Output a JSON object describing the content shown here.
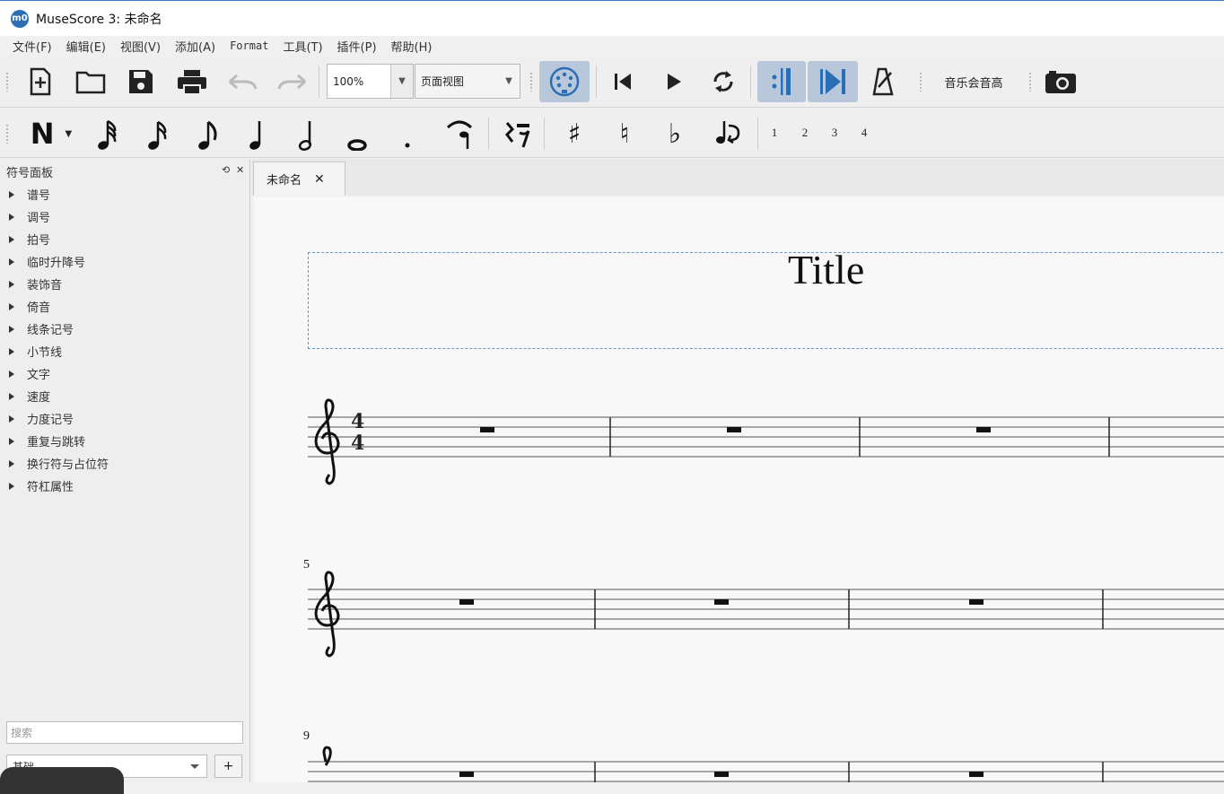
{
  "window": {
    "title": "MuseScore 3: 未命名",
    "app_icon_text": "m0"
  },
  "menu": [
    "文件(F)",
    "编辑(E)",
    "视图(V)",
    "添加(A)",
    "Format",
    "工具(T)",
    "插件(P)",
    "帮助(H)"
  ],
  "toolbar": {
    "zoom_value": "100%",
    "view_mode": "页面视图",
    "concert_pitch_label": "音乐会音高"
  },
  "note_toolbar": {
    "voices": [
      "1",
      "2",
      "3",
      "4"
    ]
  },
  "palette": {
    "header": "符号面板",
    "items": [
      "谱号",
      "调号",
      "拍号",
      "临时升降号",
      "装饰音",
      "倚音",
      "线条记号",
      "小节线",
      "文字",
      "速度",
      "力度记号",
      "重复与跳转",
      "换行符与占位符",
      "符杠属性"
    ],
    "search_placeholder": "搜索",
    "workspace": "基础"
  },
  "tabs": [
    {
      "label": "未命名"
    }
  ],
  "score": {
    "title": "Title",
    "time_signature": {
      "top": "4",
      "bottom": "4"
    },
    "measure_numbers": [
      "5",
      "9"
    ]
  },
  "colors": {
    "accent": "#3b7fc4",
    "toggle_on": "#b8c8da",
    "frame": "#5b9bd5"
  }
}
